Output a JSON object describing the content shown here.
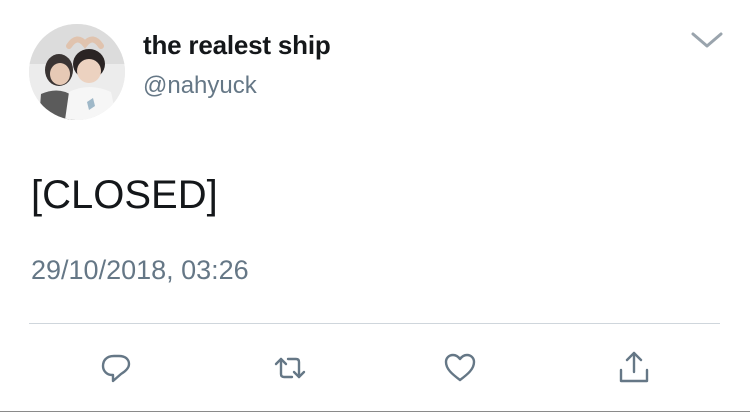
{
  "tweet": {
    "display_name": "the realest ship",
    "handle": "@nahyuck",
    "text": "[CLOSED]",
    "timestamp": "29/10/2018, 03:26"
  },
  "icons": {
    "avatar": "profile-photo",
    "menu": "chevron-down-icon",
    "reply": "reply-icon",
    "retweet": "retweet-icon",
    "like": "heart-icon",
    "share": "share-icon"
  },
  "colors": {
    "name": "#14171a",
    "secondary": "#657786",
    "icon": "#657786",
    "divider": "#cfd6dc"
  }
}
